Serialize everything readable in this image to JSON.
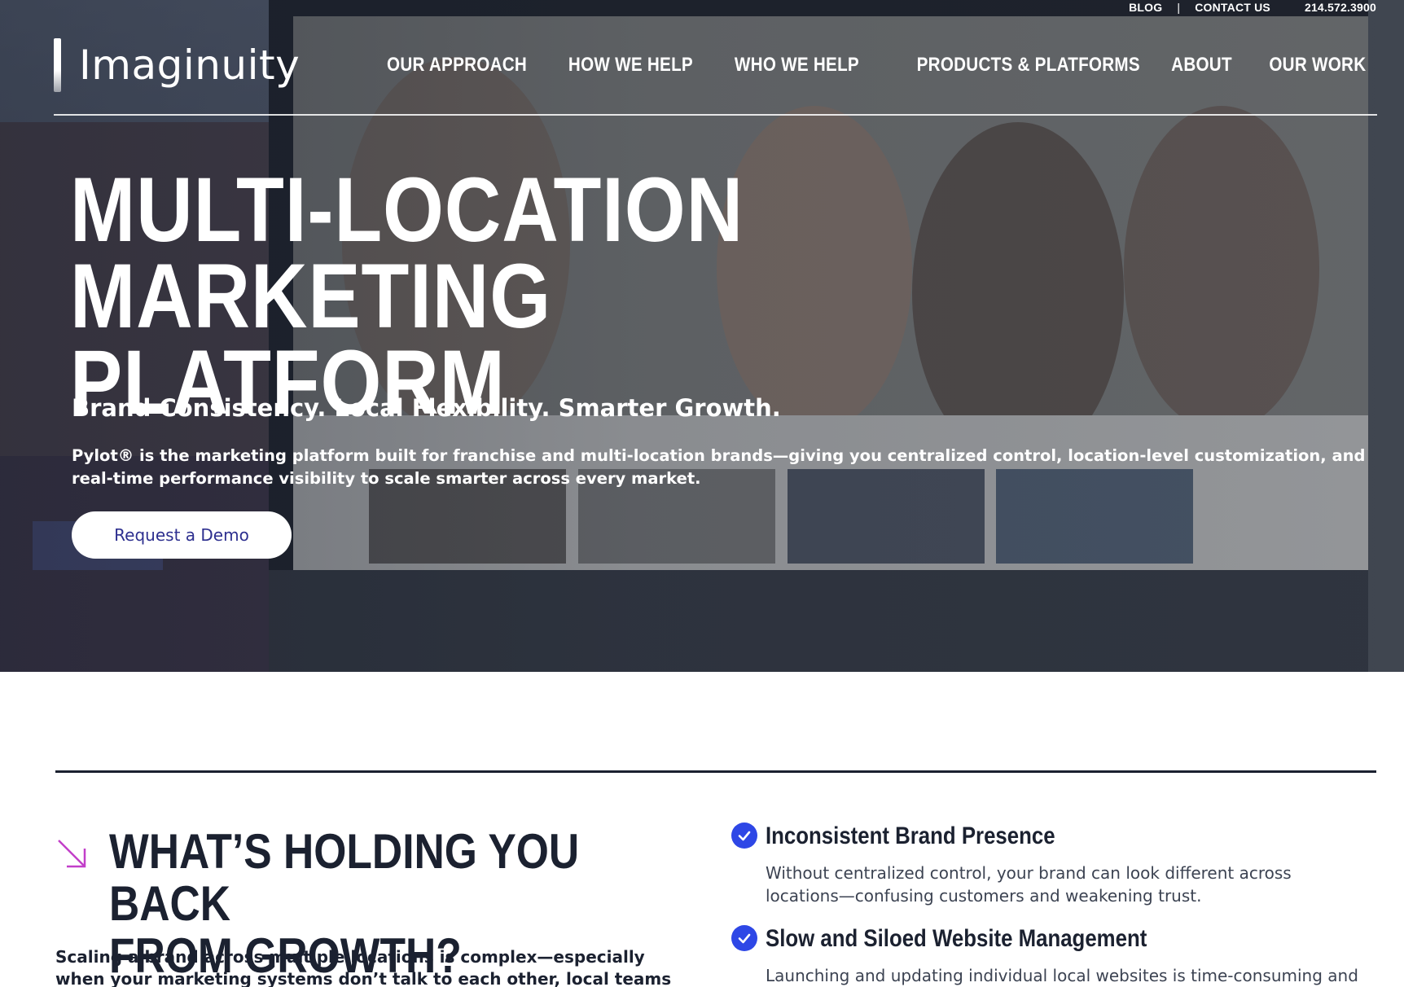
{
  "topbar": {
    "blog": "BLOG",
    "separator": "|",
    "contact": "CONTACT US",
    "phone": "214.572.3900"
  },
  "logo": {
    "text": "Imaginuity"
  },
  "nav": {
    "items": [
      {
        "label": "OUR APPROACH"
      },
      {
        "label": "HOW WE HELP"
      },
      {
        "label": "WHO WE HELP"
      },
      {
        "label": "PRODUCTS & PLATFORMS"
      },
      {
        "label": "ABOUT"
      },
      {
        "label": "OUR WORK"
      }
    ]
  },
  "hero": {
    "title_line1": "MULTI-LOCATION MARKETING",
    "title_line2": "PLATFORM",
    "subtitle": "Brand Consistency. Local Flexibility. Smarter Growth.",
    "description": "Pylot® is the marketing platform built for franchise and multi-location brands—giving you centralized control, location-level customization, and real-time performance visibility to scale smarter across every market.",
    "cta_label": "Request a Demo"
  },
  "section": {
    "title_line1": "WHAT’S HOLDING YOU BACK",
    "title_line2": "FROM GROWTH?",
    "body": "Scaling a brand across multiple locations is complex—especially when your marketing systems don’t talk to each other, local teams lack guidance, and",
    "accent_color": "#c23fc9",
    "issues": [
      {
        "title": "Inconsistent Brand Presence",
        "text": "Without centralized control, your brand can look different across locations—confusing customers and weakening trust."
      },
      {
        "title": "Slow and Siloed Website Management",
        "text": "Launching and updating individual local websites is time-consuming and"
      }
    ]
  },
  "colors": {
    "check_blue": "#2e47e6",
    "dark_text": "#1b2130",
    "button_text": "#2d2f8f"
  }
}
